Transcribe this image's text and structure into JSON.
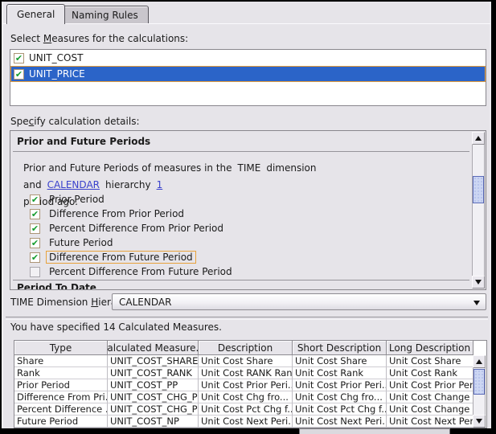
{
  "tabs": [
    {
      "label": "General",
      "active": true
    },
    {
      "label": "Naming Rules",
      "active": false
    }
  ],
  "measures_section": {
    "label_pre": "Select ",
    "label_mnemonic": "M",
    "label_post": "easures for the calculations:",
    "items": [
      {
        "label": "UNIT_COST",
        "checked": true,
        "selected": false
      },
      {
        "label": "UNIT_PRICE",
        "checked": true,
        "selected": true
      }
    ]
  },
  "details_section": {
    "label_pre": "Spe",
    "label_mnemonic": "c",
    "label_post": "ify calculation details:",
    "group_title": "Prior and Future Periods",
    "sentence": {
      "part1": "Prior and Future Periods of measures in the",
      "dimension": "TIME",
      "part2": "dimension and",
      "hierarchy_link": "CALENDAR",
      "part3": "hierarchy",
      "periods_link": "1",
      "part4": "period ago."
    },
    "options": [
      {
        "label": "Prior Period",
        "checked": true,
        "focused": false
      },
      {
        "label": "Difference From Prior Period",
        "checked": true,
        "focused": false
      },
      {
        "label": "Percent Difference From Prior Period",
        "checked": true,
        "focused": false
      },
      {
        "label": "Future Period",
        "checked": true,
        "focused": false
      },
      {
        "label": "Difference From Future Period",
        "checked": true,
        "focused": true
      },
      {
        "label": "Percent Difference From Future Period",
        "checked": false,
        "focused": false
      }
    ],
    "next_group_title": "Period To Date"
  },
  "hierarchy_section": {
    "label_pre": "TIME Dimension ",
    "label_mnemonic": "H",
    "label_post": "ierarchy:",
    "selected_value": "CALENDAR"
  },
  "summary_text": "You have specified 14 Calculated Measures.",
  "table": {
    "columns": [
      "Type",
      "Calculated Measure...",
      "Description",
      "Short Description",
      "Long Description"
    ],
    "rows": [
      [
        "Share",
        "UNIT_COST_SHARE",
        "Unit Cost Share",
        "Unit Cost Share",
        "Unit Cost Share"
      ],
      [
        "Rank",
        "UNIT_COST_RANK",
        "Unit Cost RANK Rank",
        "Unit Cost Rank",
        "Unit Cost Rank"
      ],
      [
        "Prior Period",
        "UNIT_COST_PP",
        "Unit Cost Prior Peri...",
        "Unit Cost Prior Peri...",
        "Unit Cost Prior Peri..."
      ],
      [
        "Difference From Pri...",
        "UNIT_COST_CHG_PP",
        "Unit Cost Chg fro...",
        "Unit Cost Chg fro...",
        "Unit Cost Change f..."
      ],
      [
        "Percent Difference ...",
        "UNIT_COST_CHG_PP",
        "Unit Cost Pct Chg f...",
        "Unit Cost Pct Chg f...",
        "Unit Cost Change f..."
      ],
      [
        "Future Period",
        "UNIT_COST_NP",
        "Unit Cost Next Peri...",
        "Unit Cost Next Peri...",
        "Unit Cost Next Peri..."
      ]
    ]
  },
  "colors": {
    "selection_blue": "#2b64c8",
    "focus_orange": "#e29a3c",
    "check_green": "#149c2e",
    "link_blue": "#3a41cc",
    "dialog_background": "#e6e4e9",
    "scroll_thumb_blue": "#ccd6f3"
  }
}
